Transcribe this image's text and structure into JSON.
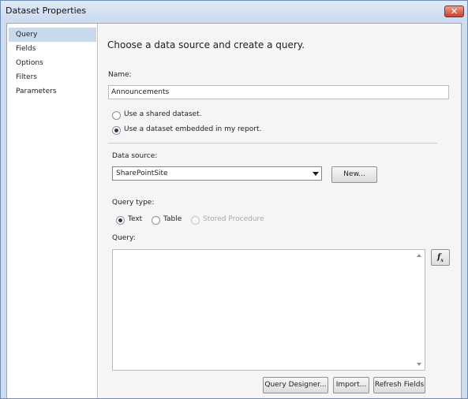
{
  "window": {
    "title": "Dataset Properties",
    "close_glyph": "✕"
  },
  "nav": {
    "items": [
      {
        "label": "Query",
        "selected": true
      },
      {
        "label": "Fields"
      },
      {
        "label": "Options"
      },
      {
        "label": "Filters"
      },
      {
        "label": "Parameters"
      }
    ]
  },
  "content": {
    "heading": "Choose a data source and create a query.",
    "name_label": "Name:",
    "name_value": "Announcements",
    "dataset_options": [
      {
        "label": "Use a shared dataset.",
        "checked": false
      },
      {
        "label": "Use a dataset embedded in my report.",
        "checked": true
      }
    ],
    "data_source_label": "Data source:",
    "data_source_value": "SharePointSite",
    "new_button": "New...",
    "query_type_label": "Query type:",
    "query_types": [
      {
        "label": "Text",
        "checked": true,
        "disabled": false
      },
      {
        "label": "Table",
        "checked": false,
        "disabled": false
      },
      {
        "label": "Stored Procedure",
        "checked": false,
        "disabled": true
      }
    ],
    "query_label": "Query:",
    "query_text": "",
    "expression_button": {
      "icon": "function-fx-icon",
      "text": "f",
      "subscript": "x"
    },
    "buttons": {
      "query_designer": "Query Designer...",
      "import": "Import...",
      "refresh_fields": "Refresh Fields"
    }
  },
  "colors": {
    "title_bar": "#cddcee",
    "nav_selected": "#c8d9ec",
    "close_button": "#c8402c",
    "content_bg": "#f6f4f5"
  }
}
